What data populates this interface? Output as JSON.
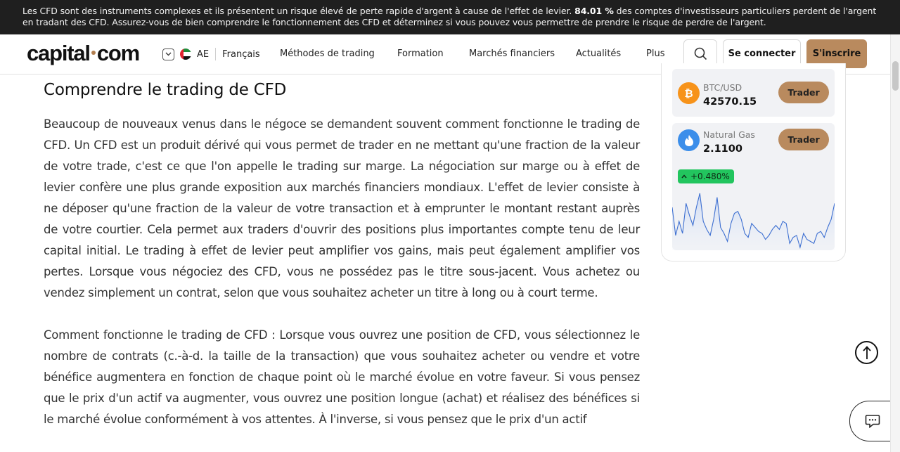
{
  "risk_banner": {
    "text_before": "Les CFD sont des instruments complexes et ils présentent un risque élevé de perte rapide d'argent à cause de l'effet de levier. ",
    "percentage": "84.01 %",
    "text_after": " des comptes d'investisseurs particuliers perdent de l'argent en tradant des CFD. Assurez-vous de bien comprendre le fonctionnement des CFD et déterminez si vous pouvez vous permettre de prendre le risque de perdre de l'argent."
  },
  "header": {
    "logo_left": "capital",
    "logo_right": "com",
    "region_code": "AE",
    "language": "Français",
    "nav": [
      "Méthodes de trading",
      "Formation",
      "Marchés financiers",
      "Actualités",
      "Plus"
    ],
    "login_label": "Se connecter",
    "signup_label": "S'inscrire",
    "icons": {
      "search": "search-icon",
      "region_toggle": "chevron-down-icon",
      "flag": "uae-flag-icon"
    }
  },
  "article": {
    "heading": "Comprendre le trading de CFD",
    "paragraphs": [
      "Beaucoup de nouveaux venus dans le négoce se demandent souvent comment fonctionne le trading de CFD. Un CFD est un produit dérivé qui vous permet de trader en ne mettant qu'une fraction de la valeur de votre trade, c'est ce que l'on appelle le trading sur marge. La négociation sur marge ou à effet de levier confère une plus grande exposition aux marchés financiers mondiaux. L'effet de levier consiste à ne déposer qu'une fraction de la valeur de votre transaction et à emprunter le montant restant auprès de votre courtier. Cela permet aux traders d'ouvrir des positions plus importantes compte tenu de leur capital initial. Le trading à effet de levier peut amplifier vos gains, mais peut également amplifier vos pertes. Lorsque vous négociez des CFD, vous ne possédez pas le titre sous-jacent. Vous achetez ou vendez simplement un contrat, selon que vous souhaitez acheter un titre à long ou à court terme.",
      "Comment fonctionne le trading de CFD : Lorsque vous ouvrez une position de CFD, vous sélectionnez le nombre de contrats (c.-à-d. la taille de la transaction) que vous souhaitez acheter ou vendre et votre bénéfice augmentera en fonction de chaque point où le marché évolue en votre faveur. Si vous pensez que le prix d'un actif va augmenter, vous ouvrez une position longue (achat) et réalisez des bénéfices si le marché évolue conformément à vos attentes. À l'inverse, si vous pensez que le prix d'un actif"
    ]
  },
  "sidebar": {
    "instruments": [
      {
        "name": "BTC/USD",
        "price": "42570.15",
        "button": "Trader",
        "icon": "bitcoin-icon",
        "icon_glyph": "₿",
        "color": "#f7931a"
      },
      {
        "name": "Natural Gas",
        "price": "2.1100",
        "button": "Trader",
        "icon": "flame-icon",
        "icon_glyph": "🔥",
        "color": "#3b8eea",
        "change": "+0.480%",
        "change_icon": "chevron-up-icon"
      }
    ],
    "sparkline": [
      44,
      72,
      58,
      70,
      40,
      52,
      62,
      44,
      30,
      58,
      66,
      72,
      56,
      34,
      64,
      70,
      78,
      60,
      50,
      48,
      56,
      70,
      74,
      60,
      64,
      68,
      70,
      76,
      72,
      66,
      62,
      66,
      58,
      60,
      80,
      74,
      72,
      84,
      70,
      76,
      78,
      80,
      70,
      68,
      74,
      64,
      56,
      40
    ]
  },
  "floating": {
    "scroll_top_icon": "arrow-up-icon",
    "chat_icon": "chat-icon"
  }
}
